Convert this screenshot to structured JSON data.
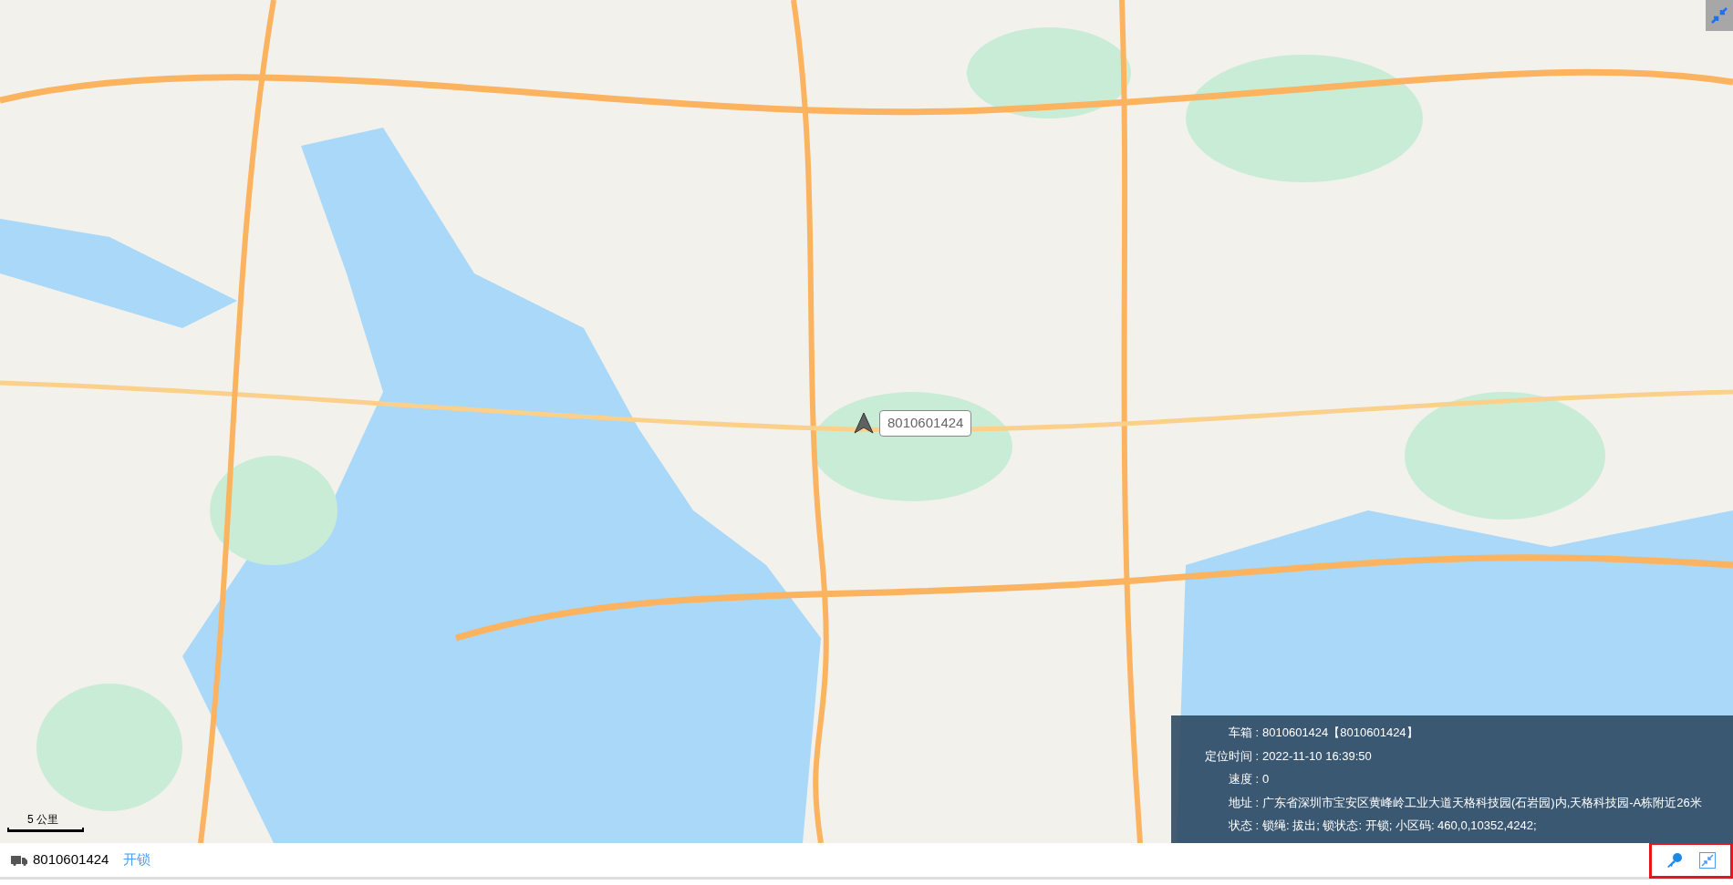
{
  "map": {
    "marker_label": "8010601424",
    "scale": "5 公里"
  },
  "info_panel": {
    "fields": [
      {
        "label": "车箱 :",
        "value": "8010601424【8010601424】"
      },
      {
        "label": "定位时间 :",
        "value": "2022-11-10 16:39:50"
      },
      {
        "label": "速度 :",
        "value": "0"
      },
      {
        "label": "地址 :",
        "value": "广东省深圳市宝安区黄峰岭工业大道天格科技园(石岩园)内,天格科技园-A栋附近26米"
      },
      {
        "label": "状态 :",
        "value": "锁绳: 拔出; 锁状态: 开锁; 小区码: 460,0,10352,4242;"
      }
    ]
  },
  "bottom_bar": {
    "vehicle_id": "8010601424",
    "unlock_link": "开锁",
    "highlighted": true
  }
}
